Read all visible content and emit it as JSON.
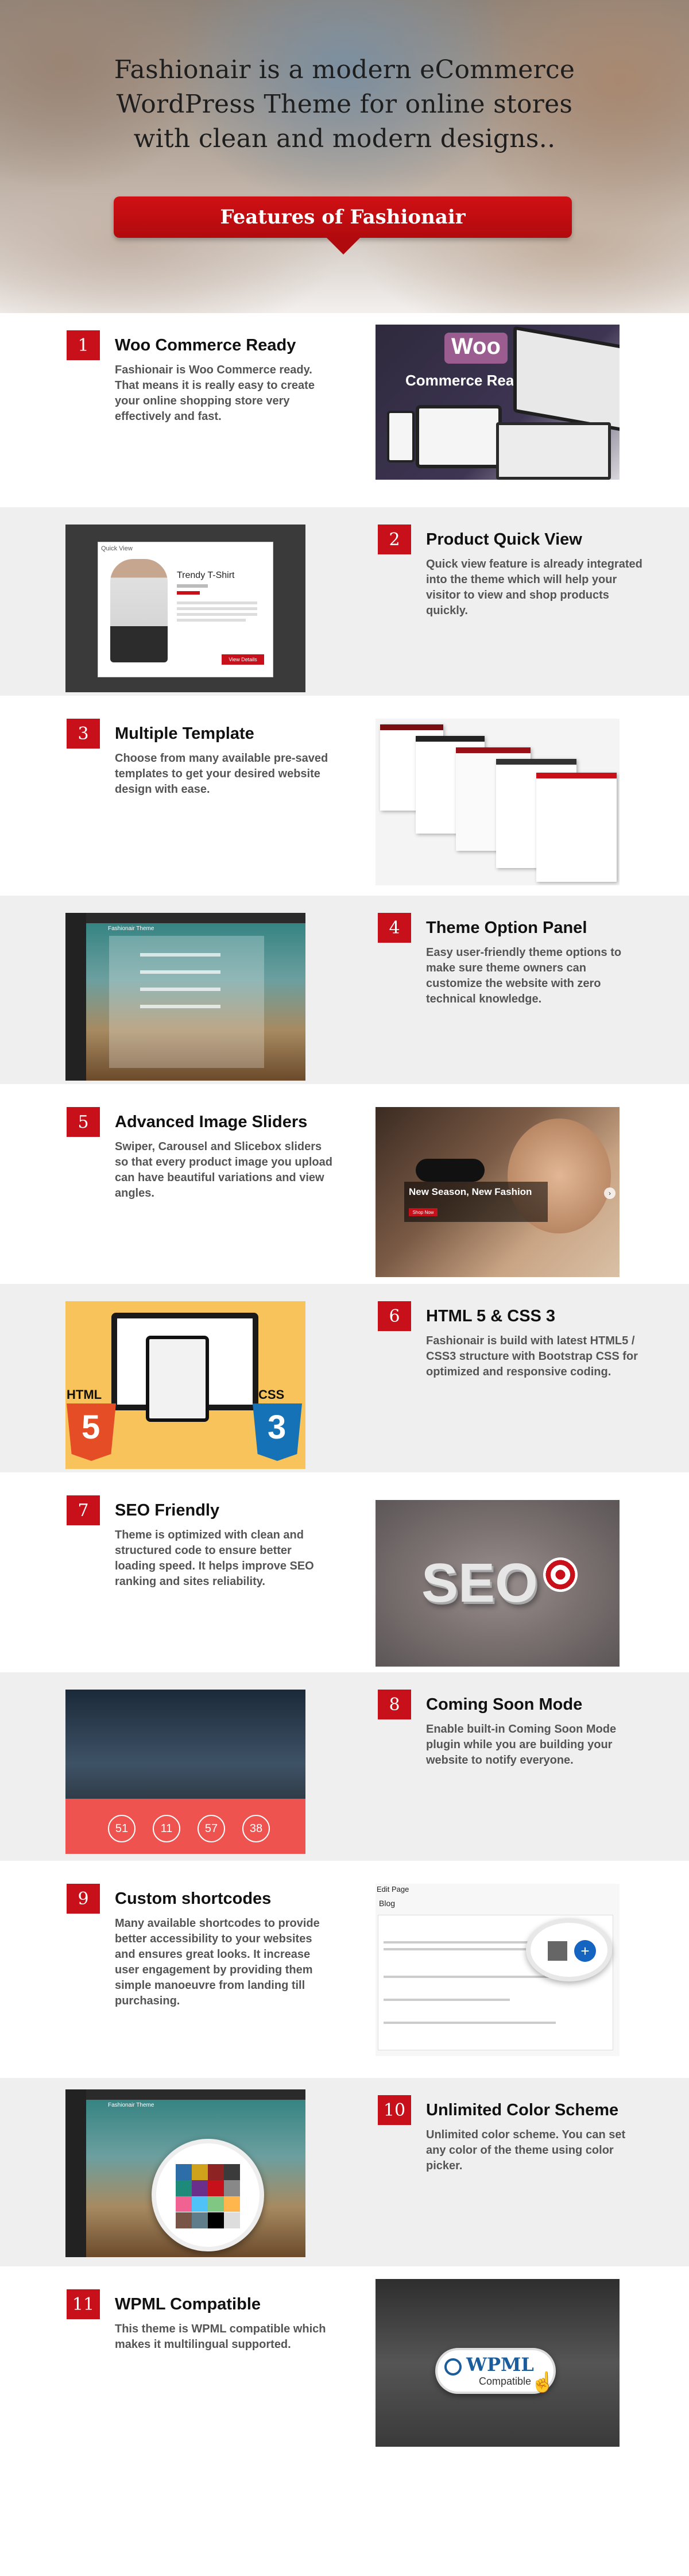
{
  "hero": {
    "line1": "Fashionair is a modern eCommerce",
    "line2": "WordPress Theme for online stores",
    "line3": "with clean and modern designs..",
    "ribbon": "Features of Fashionair"
  },
  "features": [
    {
      "num": "1",
      "title": "Woo Commerce Ready",
      "desc": "Fashionair is Woo Commerce ready. That means it is really easy to create your online shopping store very effectively and fast."
    },
    {
      "num": "2",
      "title": "Product Quick View",
      "desc": "Quick view feature is already integrated into the theme which will help your visitor to view and shop products quickly."
    },
    {
      "num": "3",
      "title": "Multiple Template",
      "desc": "Choose from many available pre-saved templates to get your desired website design with ease."
    },
    {
      "num": "4",
      "title": "Theme Option Panel",
      "desc": "Easy user-friendly theme options to make sure theme owners can customize the website with zero technical knowledge."
    },
    {
      "num": "5",
      "title": "Advanced Image Sliders",
      "desc": "Swiper, Carousel and Slicebox sliders so that every product image you upload can have beautiful variations and view angles."
    },
    {
      "num": "6",
      "title": "HTML 5 & CSS 3",
      "desc": "Fashionair is build with latest HTML5 / CSS3 structure with Bootstrap CSS for optimized and responsive coding."
    },
    {
      "num": "7",
      "title": "SEO Friendly",
      "desc": "Theme is optimized with clean and structured code to ensure better loading speed. It helps improve SEO ranking and sites reliability."
    },
    {
      "num": "8",
      "title": "Coming Soon Mode",
      "desc": "Enable built-in Coming Soon Mode plugin while you are building your website to notify everyone."
    },
    {
      "num": "9",
      "title": "Custom shortcodes",
      "desc": "Many available shortcodes to provide better accessibility to your websites and ensures great looks. It increase user engagement by providing them simple manoeuvre from landing till purchasing."
    },
    {
      "num": "10",
      "title": "Unlimited Color Scheme",
      "desc": "Unlimited color scheme. You can set any color of the theme using color picker."
    },
    {
      "num": "11",
      "title": "WPML Compatible",
      "desc": "This theme is WPML compatible which makes it multilingual supported."
    }
  ],
  "shots": {
    "woo_logo": "Woo",
    "woo_caption": "Commerce Ready",
    "quickview_label": "Quick View",
    "quickview_product": "Trendy T-Shirt",
    "quickview_button": "View Details",
    "slider_heading": "New Season, New Fashion",
    "slider_button": "Shop Now",
    "html_label": "HTML",
    "html_num": "5",
    "css_label": "CSS",
    "css_num": "3",
    "seo_text": "SEO",
    "countdown": [
      "51",
      "11",
      "57",
      "38"
    ],
    "editor_title": "Edit Page",
    "editor_subtitle": "Blog",
    "wpml_text": "WPML",
    "wpml_sub": "Compatible",
    "theme_panel_title": "Fashionair Theme"
  },
  "colors": {
    "accent": "#c8101a",
    "gray_band": "#efefef"
  }
}
